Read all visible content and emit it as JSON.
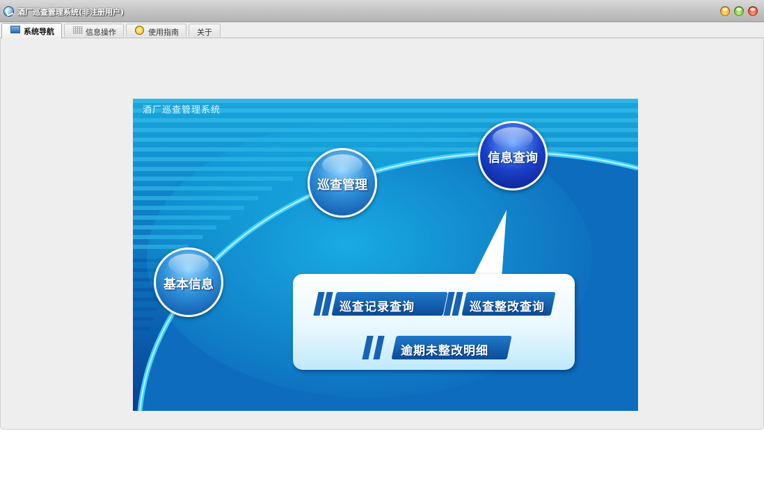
{
  "window": {
    "title": "酒厂巡查管理系统(非注册用户)"
  },
  "tabs": [
    {
      "label": "系统导航",
      "icon": "monitor-icon",
      "active": true
    },
    {
      "label": "信息操作",
      "icon": "grid-icon",
      "active": false
    },
    {
      "label": "使用指南",
      "icon": "clock-icon",
      "active": false
    },
    {
      "label": "关于",
      "icon": "",
      "active": false
    }
  ],
  "banner": {
    "title": "酒厂巡查管理系统",
    "nodes": [
      {
        "label": "基本信息"
      },
      {
        "label": "巡查管理"
      },
      {
        "label": "信息查询"
      }
    ],
    "panel_buttons": [
      {
        "label": "巡查记录查询"
      },
      {
        "label": "巡查整改查询"
      },
      {
        "label": "逾期未整改明细"
      }
    ]
  },
  "colors": {
    "banner_light": "#1aa7dc",
    "banner_dark": "#0a3f92",
    "button_blue": "#0b4b9a"
  }
}
